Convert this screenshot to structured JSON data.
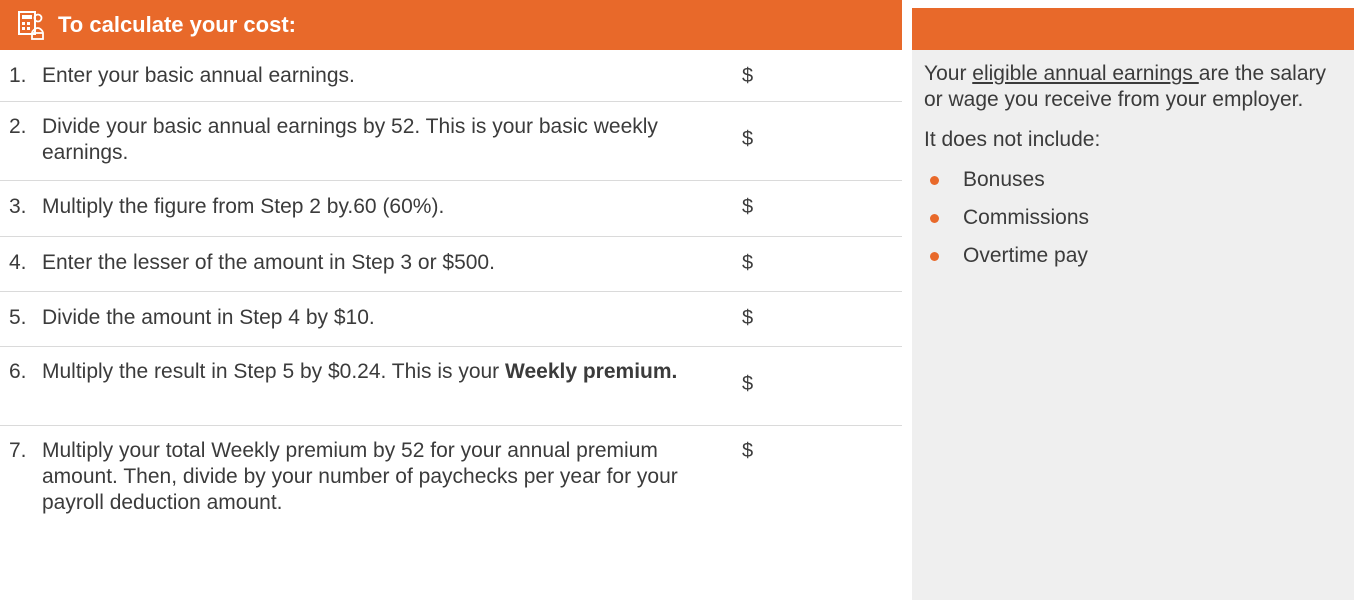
{
  "calculator": {
    "title": "To calculate your cost:",
    "icon": "calculator-icon",
    "steps": [
      {
        "num": "1.",
        "text": "Enter your basic annual earnings.",
        "dollar": "$"
      },
      {
        "num": "2.",
        "text": "Divide your basic annual earnings by 52. This is your basic weekly earnings.",
        "dollar": "$"
      },
      {
        "num": "3.",
        "text": "Multiply the figure from Step 2 by.60 (60%).",
        "dollar": "$"
      },
      {
        "num": "4.",
        "text": "Enter the lesser of the amount in Step 3 or $500.",
        "dollar": "$"
      },
      {
        "num": "5.",
        "text": "Divide the amount in Step 4 by $10.",
        "dollar": "$"
      },
      {
        "num": "6.",
        "text": "Multiply the result in Step 5 by $0.24. This is your ",
        "bold": "Weekly premium.",
        "dollar": "$"
      },
      {
        "num": "7.",
        "text": "Multiply your total Weekly premium by 52 for your annual premium amount. Then, divide by your number of paychecks per year for your payroll deduction amount.",
        "dollar": "$"
      }
    ]
  },
  "sidebar": {
    "intro_before": "Your ",
    "intro_link": "eligible annual earnings ",
    "intro_after": "are the salary or wage you receive from your employer.",
    "exclude_label": "It does not include:",
    "items": [
      "Bonuses",
      "Commissions",
      "Overtime pay"
    ]
  },
  "colors": {
    "accent": "#e8692a",
    "sidebar_bg": "#efefef",
    "text": "#3b3b3b"
  }
}
